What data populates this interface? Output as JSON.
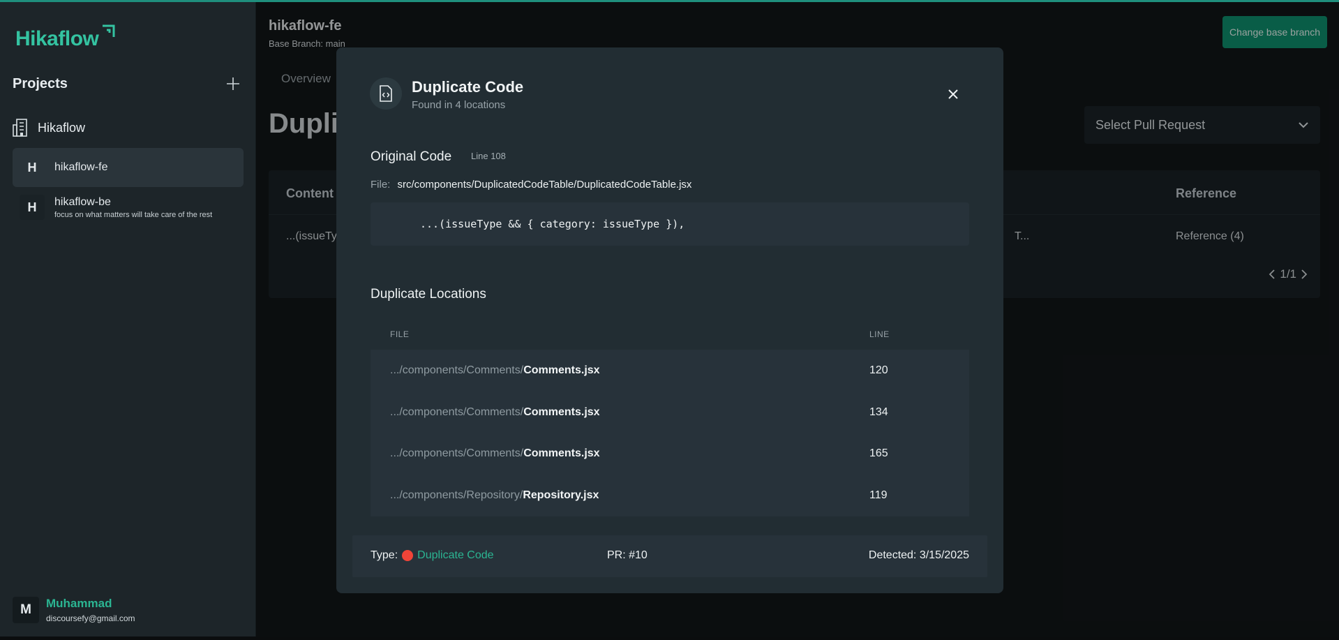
{
  "brand": {
    "name": "Hikaflow",
    "accent": "#34c3a1"
  },
  "sidebar": {
    "projects_title": "Projects",
    "org_name": "Hikaflow",
    "items": [
      {
        "initial": "H",
        "name": "hikaflow-fe",
        "description": ""
      },
      {
        "initial": "H",
        "name": "hikaflow-be",
        "description": "focus on what matters will take care of the rest"
      }
    ],
    "user": {
      "initial": "M",
      "name": "Muhammad",
      "email": "discoursefy@gmail.com"
    }
  },
  "header": {
    "repo_title": "hikaflow-fe",
    "base_branch": "Base Branch: main",
    "change_branch_label": "Change base branch"
  },
  "main": {
    "tab_overview": "Overview",
    "heading": "Dupli",
    "pr_select_label": "Select Pull Request",
    "table": {
      "col_content": "Content",
      "col_reference": "Reference",
      "row_content": "...(issueTy",
      "row_truncated": "T...",
      "row_reference": "Reference (4)",
      "pagination": "1/1"
    }
  },
  "modal": {
    "title": "Duplicate Code",
    "subtitle": "Found in 4 locations",
    "original_title": "Original Code",
    "original_line": "Line 108",
    "file_label": "File:",
    "file_path": "src/components/DuplicatedCodeTable/DuplicatedCodeTable.jsx",
    "code": "...(issueType && { category: issueType }),",
    "locations_title": "Duplicate Locations",
    "col_file": "FILE",
    "col_line": "LINE",
    "locations": [
      {
        "dir": ".../components/Comments/",
        "file": "Comments.jsx",
        "line": "120"
      },
      {
        "dir": ".../components/Comments/",
        "file": "Comments.jsx",
        "line": "134"
      },
      {
        "dir": ".../components/Comments/",
        "file": "Comments.jsx",
        "line": "165"
      },
      {
        "dir": ".../components/Repository/",
        "file": "Repository.jsx",
        "line": "119"
      }
    ],
    "footer": {
      "type_label": "Type:",
      "type_value": "Duplicate Code",
      "type_color": "#f04438",
      "pr": "PR: #10",
      "detected": "Detected: 3/15/2025"
    }
  }
}
